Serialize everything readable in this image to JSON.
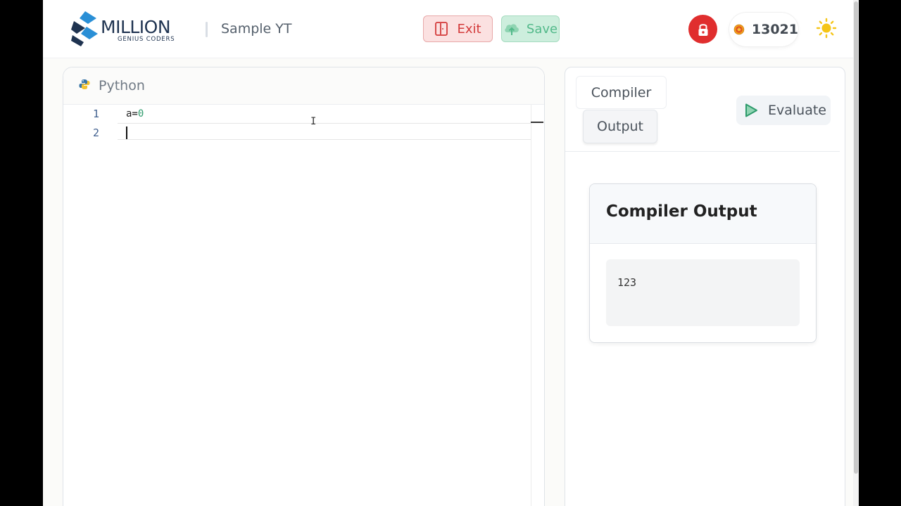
{
  "header": {
    "logo_main": "MILLION",
    "logo_sub": "GENIUS CODERS",
    "project_name": "Sample YT",
    "exit_label": "Exit",
    "save_label": "Save",
    "coins": "13021",
    "icons": [
      "logo-icon",
      "exit-door-icon",
      "cloud-upload-icon",
      "lock-icon",
      "coin-medal-icon",
      "sun-icon"
    ]
  },
  "editor": {
    "language": "Python",
    "lines": [
      {
        "number": "1",
        "text": "a=",
        "value": "0"
      },
      {
        "number": "2",
        "text": ""
      }
    ]
  },
  "right_panel": {
    "tab_compiler": "Compiler",
    "tab_output": "Output",
    "evaluate_label": "Evaluate",
    "output_title": "Compiler Output",
    "output_text": "123"
  },
  "colors": {
    "exit_bg": "#fbe1e1",
    "exit_text": "#d33a3a",
    "save_bg": "#cdeedd",
    "save_text": "#52b98a",
    "lock_bg": "#e02e2e",
    "evaluate_icon": "#2e9b6c"
  }
}
